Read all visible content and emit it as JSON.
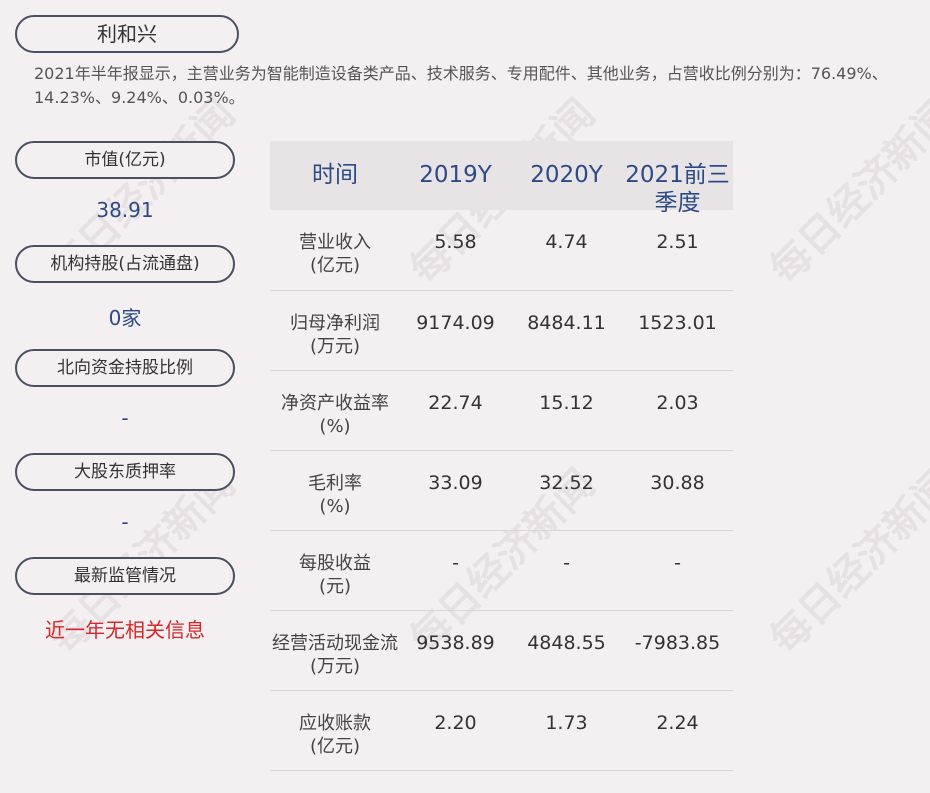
{
  "company": "利和兴",
  "intro": "2021年半年报显示，主营业务为智能制造设备类产品、技术服务、专用配件、其他业务，占营收比例分别为：76.49%、14.23%、9.24%、0.03%。",
  "sidebar": [
    {
      "label": "市值(亿元)",
      "value": "38.91"
    },
    {
      "label": "机构持股(占流通盘)",
      "value": "0家"
    },
    {
      "label": "北向资金持股比例",
      "value": "-"
    },
    {
      "label": "大股东质押率",
      "value": "-"
    },
    {
      "label": "最新监管情况",
      "value": "近一年无相关信息"
    }
  ],
  "table": {
    "headers": [
      "时间",
      "2019Y",
      "2020Y",
      "2021前三季度"
    ],
    "rows": [
      {
        "name": "营业收入",
        "unit": "(亿元)",
        "v": [
          "5.58",
          "4.74",
          "2.51"
        ]
      },
      {
        "name": "归母净利润",
        "unit": "(万元)",
        "v": [
          "9174.09",
          "8484.11",
          "1523.01"
        ]
      },
      {
        "name": "净资产收益率",
        "unit": "(%)",
        "v": [
          "22.74",
          "15.12",
          "2.03"
        ]
      },
      {
        "name": "毛利率",
        "unit": "(%)",
        "v": [
          "33.09",
          "32.52",
          "30.88"
        ]
      },
      {
        "name": "每股收益",
        "unit": "(元)",
        "v": [
          "-",
          "-",
          "-"
        ]
      },
      {
        "name": "经营活动现金流",
        "unit": "(万元)",
        "v": [
          "9538.89",
          "4848.55",
          "-7983.85"
        ]
      },
      {
        "name": "应收账款",
        "unit": "(亿元)",
        "v": [
          "2.20",
          "1.73",
          "2.24"
        ]
      }
    ]
  },
  "watermark": "每日经济新闻"
}
